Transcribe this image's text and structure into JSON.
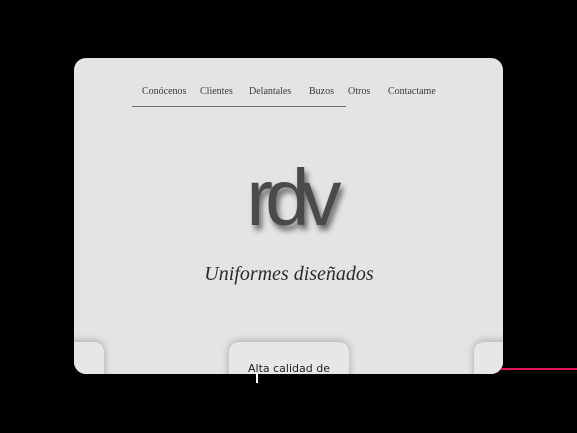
{
  "nav": {
    "items": [
      {
        "label": "Conócenos"
      },
      {
        "label": "Clientes"
      },
      {
        "label": "Delantales"
      },
      {
        "label": "Buzos"
      },
      {
        "label": "Otros"
      },
      {
        "label": "Contactame"
      }
    ]
  },
  "hero": {
    "logo_text": "rdv",
    "tagline": "Uniformes diseñados"
  },
  "features": {
    "center_title": "Alta calidad de"
  },
  "colors": {
    "background": "#000000",
    "card": "#e4e4e4",
    "accent": "#e0115f"
  }
}
